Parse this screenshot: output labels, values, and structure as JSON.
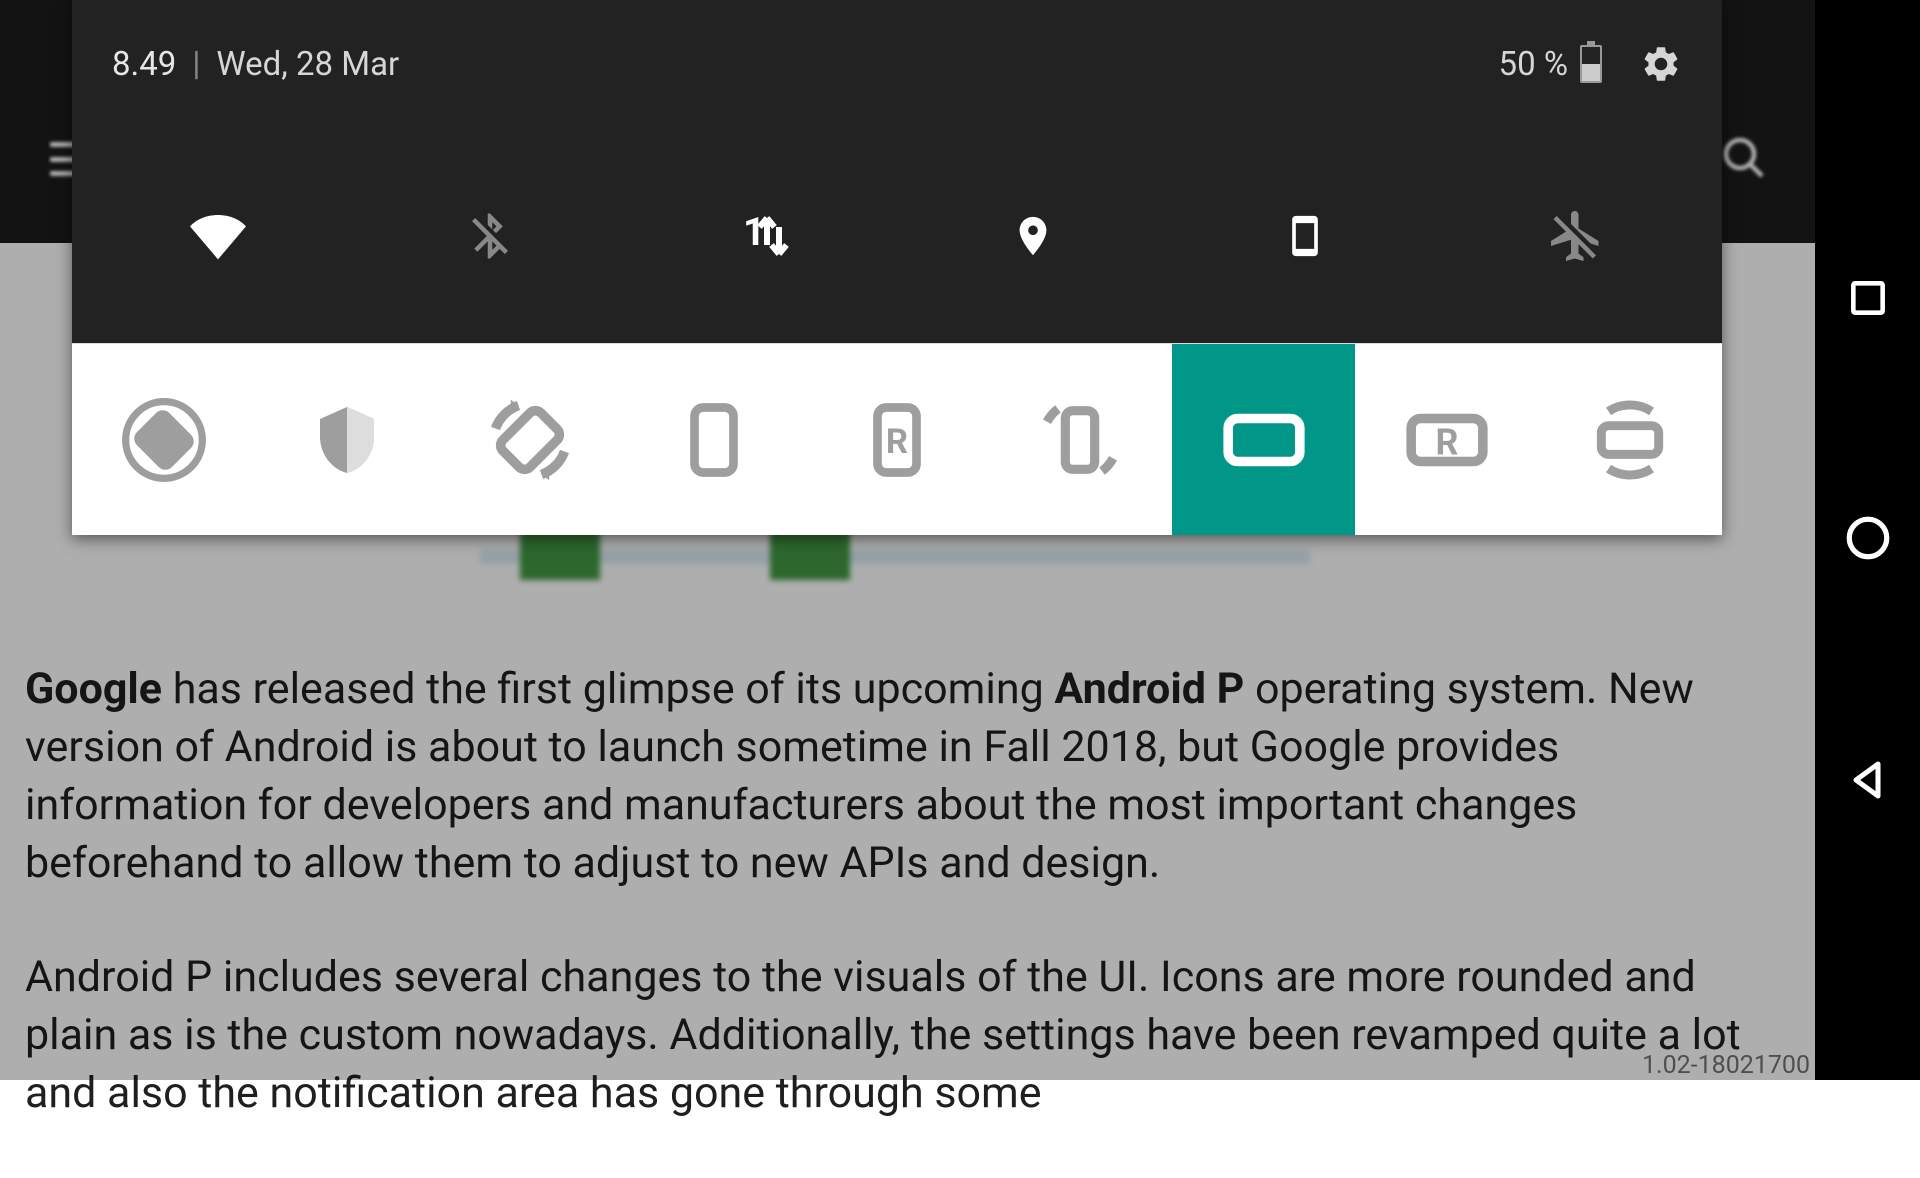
{
  "status_bar": {
    "time": "8.49",
    "separator": "|",
    "date": "Wed, 28 Mar",
    "battery_pct": "50 %"
  },
  "quick_settings": {
    "tiles": [
      {
        "name": "wifi",
        "active": true
      },
      {
        "name": "bluetooth",
        "active": false
      },
      {
        "name": "mobile-data",
        "active": true
      },
      {
        "name": "location",
        "active": true
      },
      {
        "name": "portrait",
        "active": true
      },
      {
        "name": "airplane-mode",
        "active": false
      }
    ]
  },
  "rotation_row": {
    "options": [
      {
        "name": "auto-rotate-lock"
      },
      {
        "name": "guard"
      },
      {
        "name": "auto-rotate"
      },
      {
        "name": "portrait"
      },
      {
        "name": "portrait-reverse",
        "badge": "R"
      },
      {
        "name": "rotate-portrait-sensor"
      },
      {
        "name": "landscape",
        "selected": true
      },
      {
        "name": "landscape-reverse",
        "badge": "R"
      },
      {
        "name": "rotate-landscape-sensor"
      }
    ],
    "accent_color": "#009688"
  },
  "background_page": {
    "paragraph1_parts": [
      {
        "bold": true,
        "text": "Google"
      },
      {
        "bold": false,
        "text": " has released the first glimpse of its upcoming "
      },
      {
        "bold": true,
        "text": "Android P"
      },
      {
        "bold": false,
        "text": " operating system. New version of Android is about to launch sometime in Fall 2018, but Google provides information for developers and manufacturers about the most important changes beforehand to allow them to adjust to new APIs and design."
      }
    ],
    "paragraph2": "Android P includes several changes to the visuals of the UI. Icons are more rounded and plain as is the custom nowadays. Additionally, the settings have been revamped quite a lot and also the notification area has gone through some",
    "version": "1.02-18021700"
  }
}
